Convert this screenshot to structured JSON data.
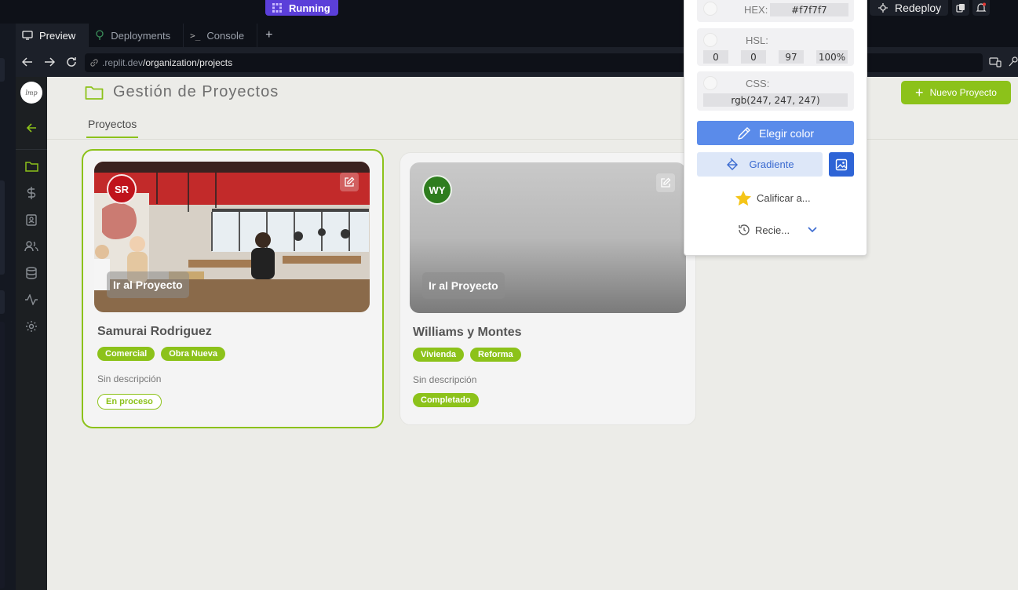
{
  "replit": {
    "status": "Running",
    "redeploy_label": "Redeploy",
    "tabs": [
      {
        "label": "Preview",
        "active": true
      },
      {
        "label": "Deployments",
        "active": false
      },
      {
        "label": "Console",
        "active": false
      }
    ],
    "url": {
      "domain": ".replit.dev",
      "path": "/organization/projects"
    }
  },
  "app": {
    "page_title": "Gestión de Proyectos",
    "tab_label": "Proyectos",
    "new_project_label": "Nuevo Proyecto",
    "accent_color": "#8cc21a",
    "sidebar_icons": [
      "arrow-left-icon",
      "folder-icon",
      "dollar-icon",
      "id-badge-icon",
      "users-icon",
      "database-icon",
      "activity-icon",
      "gear-icon"
    ],
    "projects": [
      {
        "initials": "SR",
        "avatar_color": "#c0141c",
        "goto_label": "Ir al Proyecto",
        "name": "Samurai Rodriguez",
        "tags": [
          "Comercial",
          "Obra Nueva"
        ],
        "description": "Sin descripción",
        "status": "En proceso"
      },
      {
        "initials": "WY",
        "avatar_color": "#2e7d1e",
        "goto_label": "Ir al Proyecto",
        "name": "Williams y Montes",
        "tags": [
          "Vivienda",
          "Reforma"
        ],
        "description": "Sin descripción",
        "status": "Completado"
      }
    ]
  },
  "color_picker": {
    "hex_label": "HEX:",
    "hex_value": "#f7f7f7",
    "hsl_label": "HSL:",
    "hsl_values": [
      "0",
      "0",
      "97",
      "100%"
    ],
    "css_label": "CSS:",
    "css_value": "rgb(247, 247, 247)",
    "pick_label": "Elegir color",
    "gradient_label": "Gradiente",
    "rate_label": "Calificar a...",
    "recent_label": "Recie..."
  }
}
